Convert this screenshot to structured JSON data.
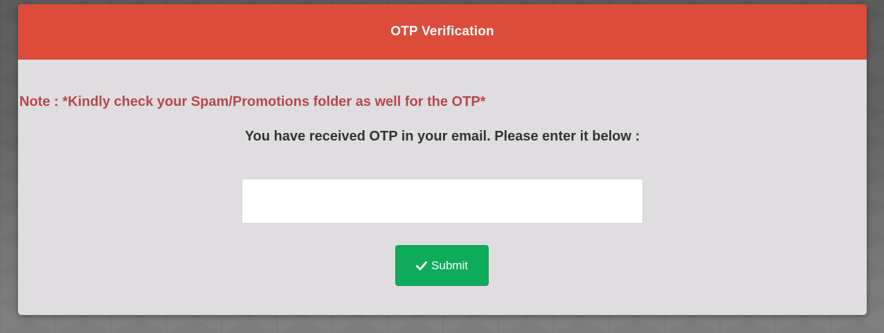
{
  "modal": {
    "title": "OTP Verification",
    "note": "Note : *Kindly check your Spam/Promotions folder as well for the OTP*",
    "instruction": "You have received OTP in your email. Please enter it below :",
    "otp_input": {
      "value": "",
      "placeholder": ""
    },
    "submit": {
      "label": "Submit",
      "icon": "check-icon"
    }
  },
  "colors": {
    "header": "#dd4c3a",
    "note_text": "#b5484b",
    "submit_bg": "#0eab5a",
    "modal_bg": "#e0dde0"
  }
}
